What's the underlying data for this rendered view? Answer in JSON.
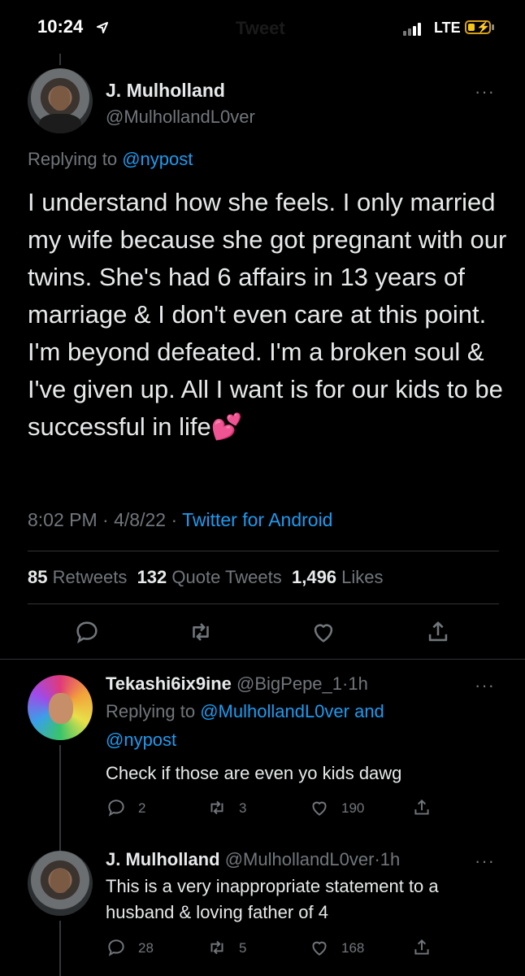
{
  "status_bar": {
    "time": "10:24",
    "network": "LTE"
  },
  "header": {
    "title": "Tweet"
  },
  "main_tweet": {
    "name": "J. Mulholland",
    "handle": "@MulhollandL0ver",
    "replying_prefix": "Replying to",
    "replying_to": "@nypost",
    "text": "I understand how she feels. I only married my wife because she got pregnant with our twins. She's had 6 affairs in 13 years of marriage & I don't even care at this point. I'm beyond defeated. I'm a broken soul & I've given up. All I want is for our kids to be successful in life💕",
    "time": "8:02 PM",
    "date": "4/8/22",
    "source": "Twitter for Android",
    "retweets": "85",
    "retweets_label": "Retweets",
    "quotes": "132",
    "quotes_label": "Quote Tweets",
    "likes": "1,496",
    "likes_label": "Likes"
  },
  "replies": [
    {
      "name": "Tekashi6ix9ine",
      "handle": "@BigPepe_1",
      "age": "1h",
      "replying_prefix": "Replying to",
      "replying_to": "@MulhollandL0ver and",
      "replying_to_2": "@nypost",
      "text": "Check if those are even yo kids dawg",
      "replies": "2",
      "retweets": "3",
      "likes": "190"
    },
    {
      "name": "J. Mulholland",
      "handle": "@MulhollandL0ver",
      "age": "1h",
      "text": "This is a very inappropriate statement to a husband & loving father of 4",
      "replies": "28",
      "retweets": "5",
      "likes": "168"
    }
  ],
  "separators": {
    "dot": "·"
  },
  "more_glyph": "···",
  "colors": {
    "accent": "#1d9bf0",
    "muted": "#71767b",
    "text": "#e7e9ea",
    "background": "#000000"
  }
}
